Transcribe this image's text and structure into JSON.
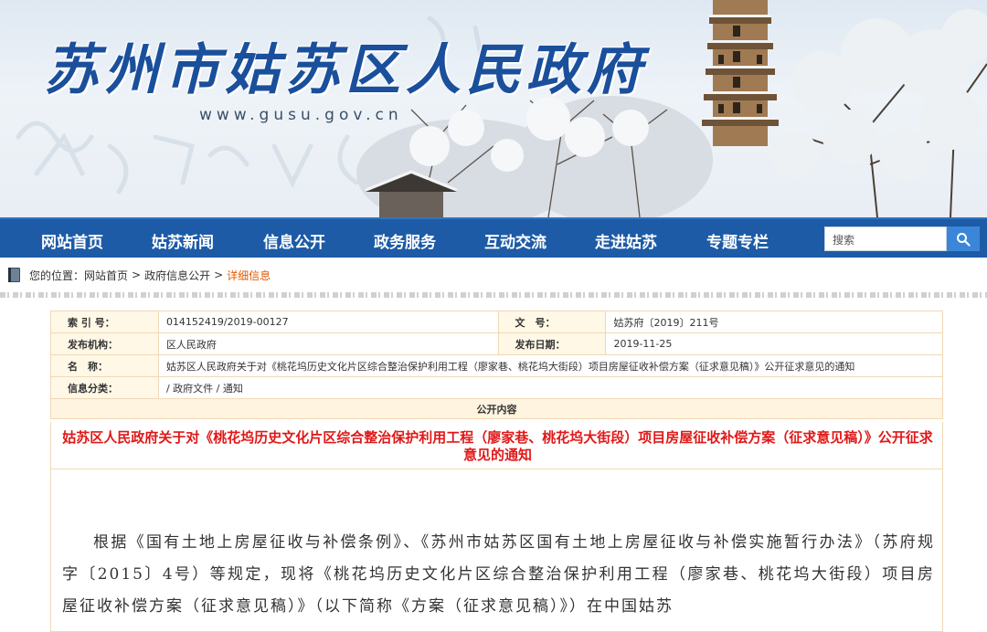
{
  "header": {
    "site_title": "苏州市姑苏区人民政府",
    "site_url": "www.gusu.gov.cn"
  },
  "nav": {
    "items": [
      "网站首页",
      "姑苏新闻",
      "信息公开",
      "政务服务",
      "互动交流",
      "走进姑苏",
      "专题专栏"
    ],
    "search_placeholder": "搜索"
  },
  "breadcrumb": {
    "prefix": "您的位置：",
    "items": [
      "网站首页",
      "政府信息公开",
      "详细信息"
    ]
  },
  "info_table": {
    "index_label": "索 引 号：",
    "index_value": "014152419/2019-00127",
    "docno_label": "文　号：",
    "docno_value": "姑苏府〔2019〕211号",
    "publisher_label": "发布机构：",
    "publisher_value": "区人民政府",
    "date_label": "发布日期：",
    "date_value": "2019-11-25",
    "name_label": "名　称：",
    "name_value": "姑苏区人民政府关于对《桃花坞历史文化片区综合整治保护利用工程（廖家巷、桃花坞大街段）项目房屋征收补偿方案（征求意见稿）》公开征求意见的通知",
    "category_label": "信息分类：",
    "category_value": "/ 政府文件 / 通知",
    "section_label": "公开内容"
  },
  "document": {
    "title": "姑苏区人民政府关于对《桃花坞历史文化片区综合整治保护利用工程（廖家巷、桃花坞大街段）项目房屋征收补偿方案（征求意见稿）》公开征求意见的通知",
    "body": "根据《国有土地上房屋征收与补偿条例》、《苏州市姑苏区国有土地上房屋征收与补偿实施暂行办法》（苏府规字〔2015〕4号）等规定，现将《桃花坞历史文化片区综合整治保护利用工程（廖家巷、桃花坞大街段）项目房屋征收补偿方案（征求意见稿）》（以下简称《方案（征求意见稿）》）在中国姑苏"
  },
  "colors": {
    "nav_bg": "#1d5ba6",
    "title_red": "#e01818",
    "crumb_current": "#e05a00",
    "table_border": "#f0d8b6",
    "brand_blue": "#1a4f9c"
  }
}
